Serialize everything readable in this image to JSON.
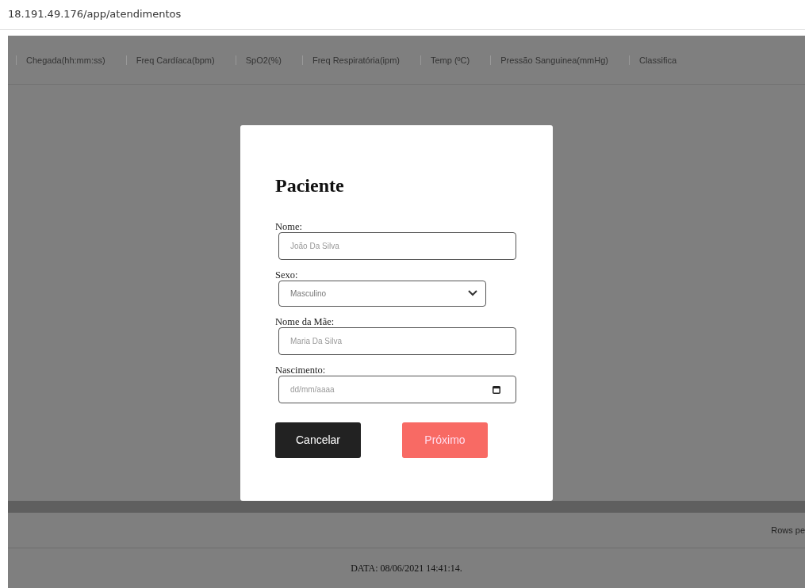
{
  "address_bar": {
    "url": "18.191.49.176/app/atendimentos"
  },
  "table": {
    "columns": [
      "Chegada(hh:mm:ss)",
      "Freq Cardíaca(bpm)",
      "SpO2(%)",
      "Freq Respiratória(ipm)",
      "Temp (ºC)",
      "Pressão Sanguinea(mmHg)",
      "Classifica"
    ]
  },
  "pagination": {
    "rows_per_page_label": "Rows pe"
  },
  "footer": {
    "text": "DATA: 08/06/2021 14:41:14."
  },
  "modal": {
    "title": "Paciente",
    "fields": [
      {
        "kind": "text",
        "label": "Nome:",
        "placeholder": "João Da Silva"
      },
      {
        "kind": "select",
        "label": "Sexo:",
        "value": "Masculino"
      },
      {
        "kind": "text",
        "label": "Nome da Mãe:",
        "placeholder": "Maria Da Silva"
      },
      {
        "kind": "date",
        "label": "Nascimento:",
        "placeholder": "dd/mm/aaaa"
      }
    ],
    "buttons": [
      {
        "kind": "dark",
        "label": "Cancelar"
      },
      {
        "kind": "primary",
        "label": "Próximo"
      }
    ]
  }
}
